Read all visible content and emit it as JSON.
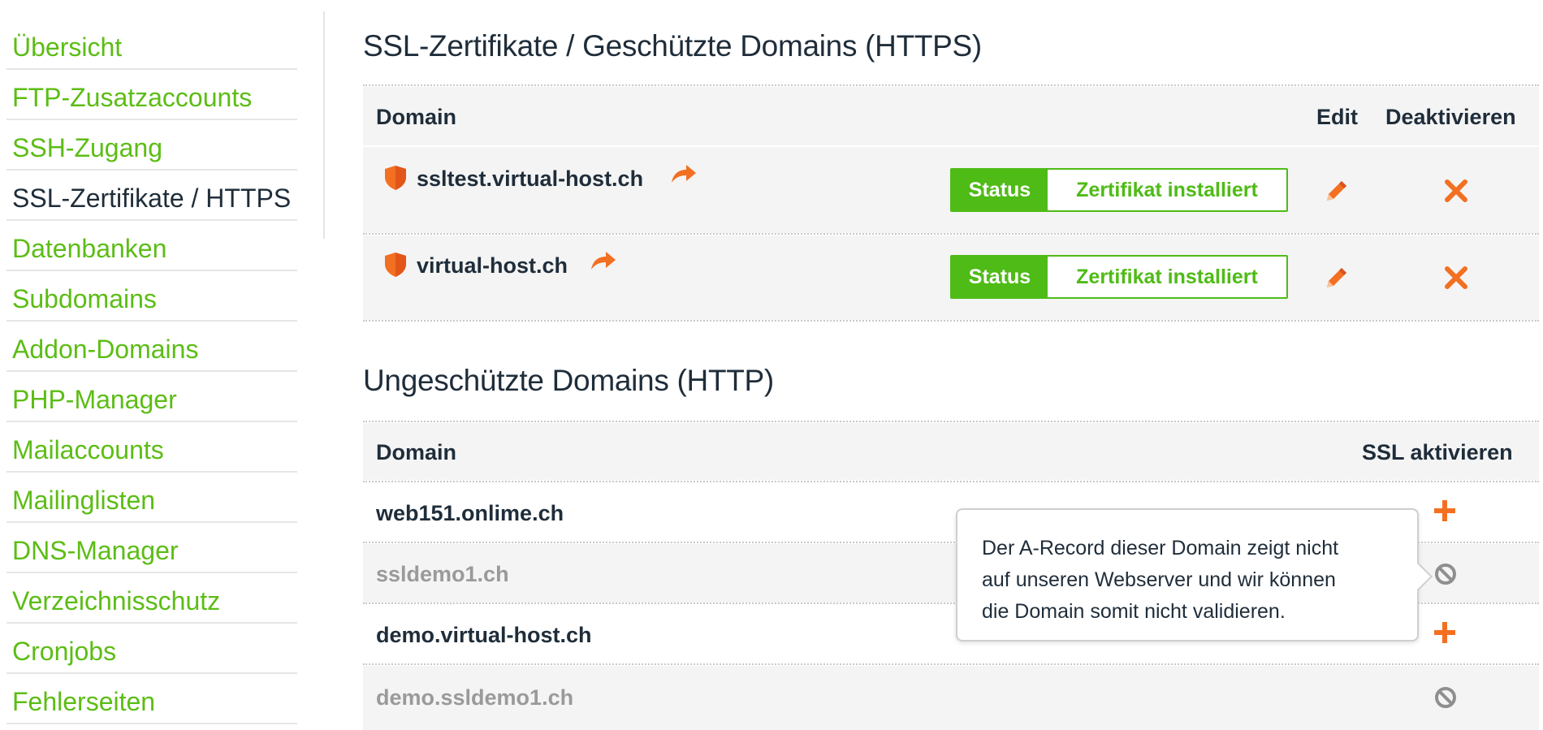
{
  "sidebar": {
    "items": [
      {
        "label": "Übersicht",
        "active": false
      },
      {
        "label": "FTP-Zusatzaccounts",
        "active": false
      },
      {
        "label": "SSH-Zugang",
        "active": false
      },
      {
        "label": "SSL-Zertifikate / HTTPS",
        "active": true
      },
      {
        "label": "Datenbanken",
        "active": false
      },
      {
        "label": "Subdomains",
        "active": false
      },
      {
        "label": "Addon-Domains",
        "active": false
      },
      {
        "label": "PHP-Manager",
        "active": false
      },
      {
        "label": "Mailaccounts",
        "active": false
      },
      {
        "label": "Mailinglisten",
        "active": false
      },
      {
        "label": "DNS-Manager",
        "active": false
      },
      {
        "label": "Verzeichnisschutz",
        "active": false
      },
      {
        "label": "Cronjobs",
        "active": false
      },
      {
        "label": "Fehlerseiten",
        "active": false
      }
    ]
  },
  "ssl_section": {
    "title": "SSL-Zertifikate / Geschützte Domains (HTTPS)",
    "headers": {
      "domain": "Domain",
      "edit": "Edit",
      "deactivate": "Deaktivieren"
    },
    "rows": [
      {
        "domain": "ssltest.virtual-host.ch",
        "status_label": "Status",
        "status_value": "Zertifikat installiert"
      },
      {
        "domain": "virtual-host.ch",
        "status_label": "Status",
        "status_value": "Zertifikat installiert"
      }
    ]
  },
  "http_section": {
    "title": "Ungeschützte Domains (HTTP)",
    "headers": {
      "domain": "Domain",
      "activate": "SSL aktivieren"
    },
    "rows": [
      {
        "domain": "web151.onlime.ch",
        "enabled": true
      },
      {
        "domain": "ssldemo1.ch",
        "enabled": false
      },
      {
        "domain": "demo.virtual-host.ch",
        "enabled": true
      },
      {
        "domain": "demo.ssldemo1.ch",
        "enabled": false
      }
    ]
  },
  "tooltip": {
    "line1": "Der A-Record dieser Domain zeigt nicht",
    "line2": "auf unseren Webserver und wir können",
    "line3": "die Domain somit nicht validieren."
  },
  "colors": {
    "accent_green": "#5cbd15",
    "status_green": "#4fbb16",
    "icon_orange": "#f36f21",
    "text_dark": "#1f2d3a",
    "text_disabled": "#9a9a9a"
  },
  "icons": {
    "shield": "shield-icon",
    "redirect": "redirect-arrow-icon",
    "edit": "pencil-icon",
    "deactivate": "close-x-icon",
    "activate": "plus-icon",
    "unavailable": "prohibited-icon"
  }
}
